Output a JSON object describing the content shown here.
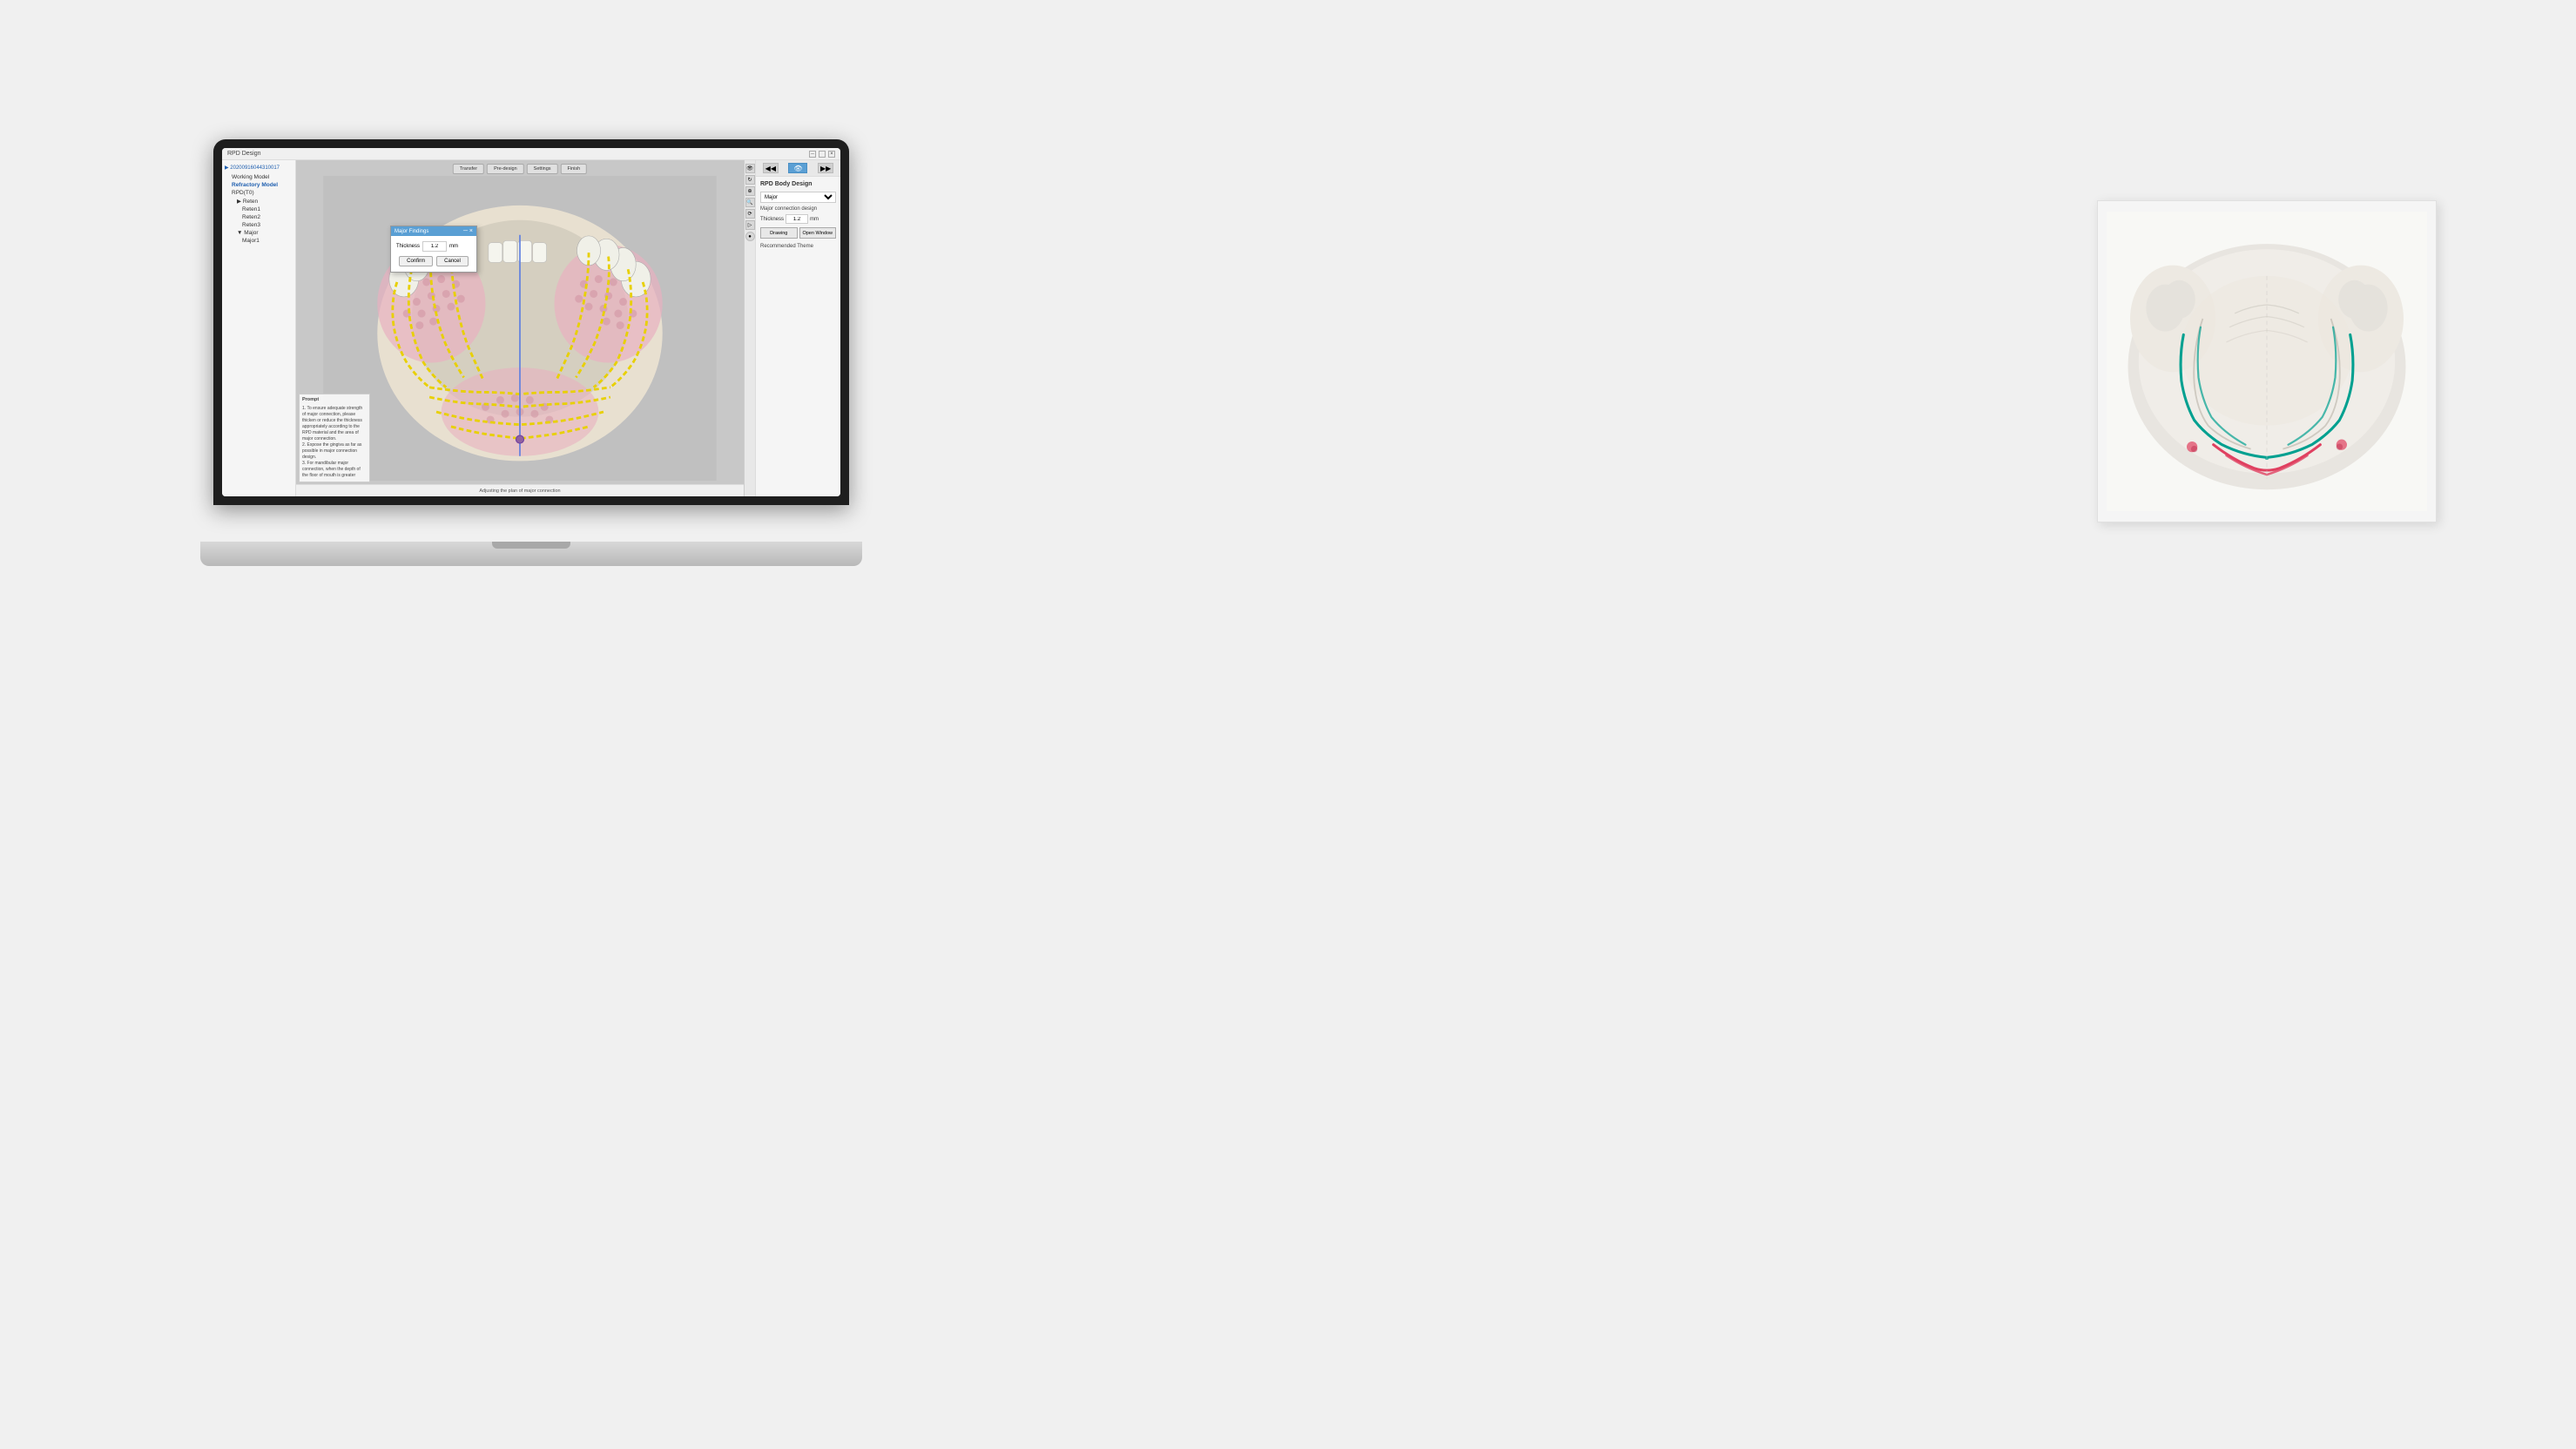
{
  "app": {
    "title": "RPD Design",
    "window_controls": [
      "minimize",
      "maximize",
      "close"
    ]
  },
  "toolbar": {
    "buttons": [
      {
        "label": "Transfer",
        "active": false
      },
      {
        "label": "Pre-design",
        "active": false
      },
      {
        "label": "Settings",
        "active": false
      },
      {
        "label": "Finish",
        "active": false
      }
    ]
  },
  "sidebar": {
    "title": "20200916044310017",
    "items": [
      {
        "label": "Working Model",
        "level": 1
      },
      {
        "label": "Refractory Model",
        "level": 1,
        "active": true
      },
      {
        "label": "RPD(T0)",
        "level": 1
      },
      {
        "label": "Reten",
        "level": 2
      },
      {
        "label": "Reten1",
        "level": 3
      },
      {
        "label": "Reten2",
        "level": 3
      },
      {
        "label": "Reten3",
        "level": 3
      },
      {
        "label": "Major",
        "level": 2
      },
      {
        "label": "Major1",
        "level": 3
      }
    ]
  },
  "dialog": {
    "title": "Major Findings",
    "thickness_label": "Thickness",
    "thickness_value": "1.2",
    "thickness_unit": "mm",
    "confirm_label": "Confirm",
    "cancel_label": "Cancel"
  },
  "right_panel": {
    "title": "RPD Body Design",
    "dropdown_label": "",
    "dropdown_value": "Major",
    "section_label": "Major connection design",
    "thickness_label": "Thickness",
    "thickness_value": "1.2",
    "thickness_unit": "mm",
    "drawing_btn": "Drawing",
    "open_window_btn": "Open Window",
    "recommended_theme_label": "Recommended Theme"
  },
  "status_bar": {
    "text": "Adjusting the plan of major connection"
  },
  "prompt": {
    "title": "Prompt",
    "lines": [
      "1. To ensure adequate strength of major connection, please thicken or reduce the thickness appropriately according to the RPD material and the area of major connection.",
      "2. Expose the gingiva as far as possible in major connection design.",
      "3. For mandibular major connection, when the depth of the floor of mouth is greater"
    ]
  }
}
